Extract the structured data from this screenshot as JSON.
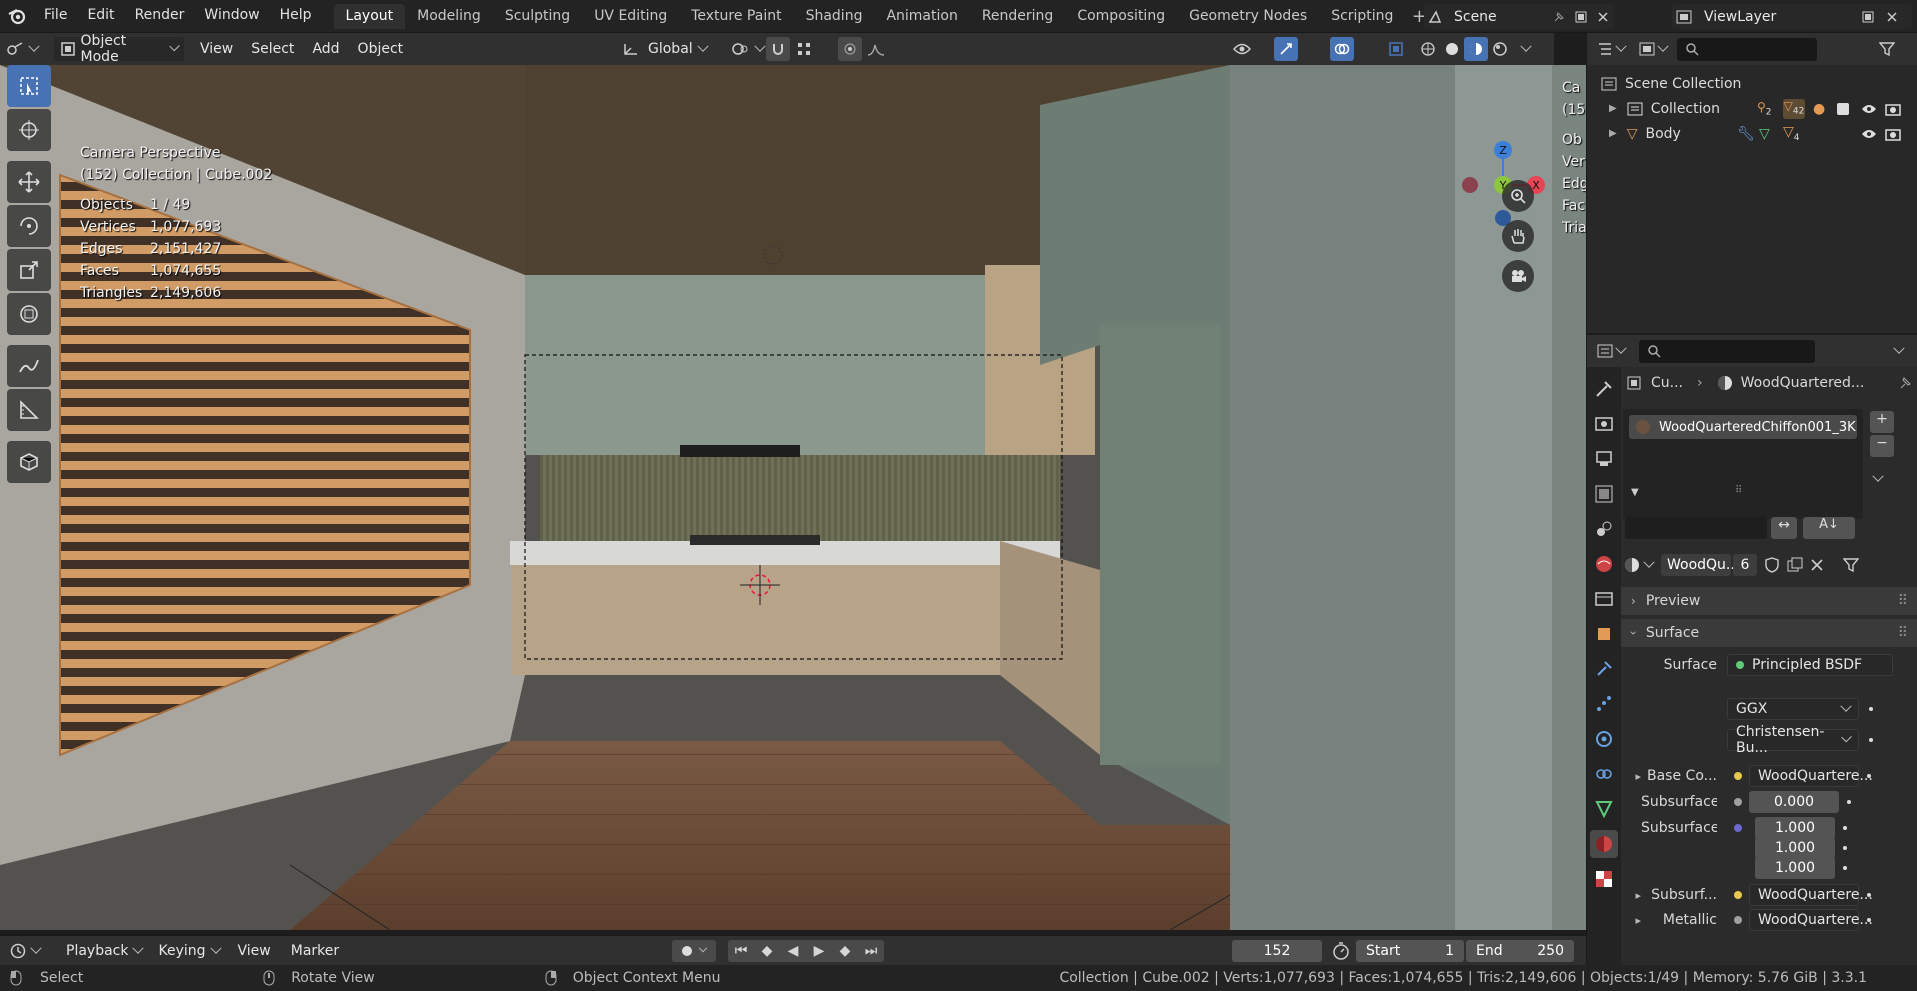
{
  "menu": [
    "File",
    "Edit",
    "Render",
    "Window",
    "Help"
  ],
  "workspaces": [
    "Layout",
    "Modeling",
    "Sculpting",
    "UV Editing",
    "Texture Paint",
    "Shading",
    "Animation",
    "Rendering",
    "Compositing",
    "Geometry Nodes",
    "Scripting"
  ],
  "scene": {
    "label": "Scene",
    "view_layer": "ViewLayer"
  },
  "viewport_header": {
    "mode": "Object Mode",
    "view": "View",
    "select": "Select",
    "add": "Add",
    "object": "Object",
    "orientation": "Global"
  },
  "overlay": {
    "title": "Camera Perspective",
    "subtitle": "(152) Collection | Cube.002",
    "stats": [
      {
        "label": "Objects",
        "value": "1 / 49"
      },
      {
        "label": "Vertices",
        "value": "1,077,693"
      },
      {
        "label": "Edges",
        "value": "2,151,427"
      },
      {
        "label": "Faces",
        "value": "1,074,655"
      },
      {
        "label": "Triangles",
        "value": "2,149,606"
      }
    ]
  },
  "gizmo": {
    "z": "Z",
    "y": "Y",
    "x": "X",
    "neg_x": "X"
  },
  "strip_text": [
    "Ca",
    "(15",
    "Ob",
    "Ver",
    "Edg",
    "Fac",
    "Tria"
  ],
  "outliner": {
    "root": "Scene Collection",
    "items": [
      {
        "label": "Collection",
        "count_a": "2",
        "count_b": "42"
      },
      {
        "label": "Body",
        "count_a": "4"
      }
    ]
  },
  "properties": {
    "breadcrumb_object": "Cu...",
    "breadcrumb_material": "WoodQuartered...",
    "slot_name": "WoodQuarteredChiffon001_3K",
    "material_name": "WoodQu...",
    "user_count": "6",
    "panels": {
      "preview": "Preview",
      "surface": "Surface"
    },
    "surface_label": "Surface",
    "surface_shader": "Principled BSDF",
    "distribution": "GGX",
    "subsurface_method": "Christensen-Bu...",
    "rows": [
      {
        "label": "Base Co...",
        "value": "WoodQuartere...",
        "dot": "#e6c84a"
      },
      {
        "label": "Subsurface",
        "value": "0.000",
        "dot": "#a0a0a0"
      },
      {
        "label": "Subsurface ...",
        "value": "1.000",
        "dot": "#6a6ad0"
      },
      {
        "label": "",
        "value": "1.000"
      },
      {
        "label": "",
        "value": "1.000"
      },
      {
        "label": "Subsurf...",
        "value": "WoodQuartere...",
        "dot": "#e6c84a"
      },
      {
        "label": "Metallic",
        "value": "WoodQuartere...",
        "dot": "#a0a0a0"
      }
    ]
  },
  "timeline": {
    "playback": "Playback",
    "keying": "Keying",
    "view": "View",
    "marker": "Marker",
    "current": "152",
    "start_label": "Start",
    "start": "1",
    "end_label": "End",
    "end": "250"
  },
  "status": {
    "select": "Select",
    "rotate": "Rotate View",
    "context": "Object Context Menu",
    "info": "Collection | Cube.002 | Verts:1,077,693 | Faces:1,074,655 | Tris:2,149,606 | Objects:1/49 | Memory: 5.76 GiB | 3.3.1"
  },
  "colors": {
    "accent": "#4772b3",
    "x_axis": "#e64553",
    "y_axis": "#8cc63e",
    "z_axis": "#3b7fd9"
  }
}
